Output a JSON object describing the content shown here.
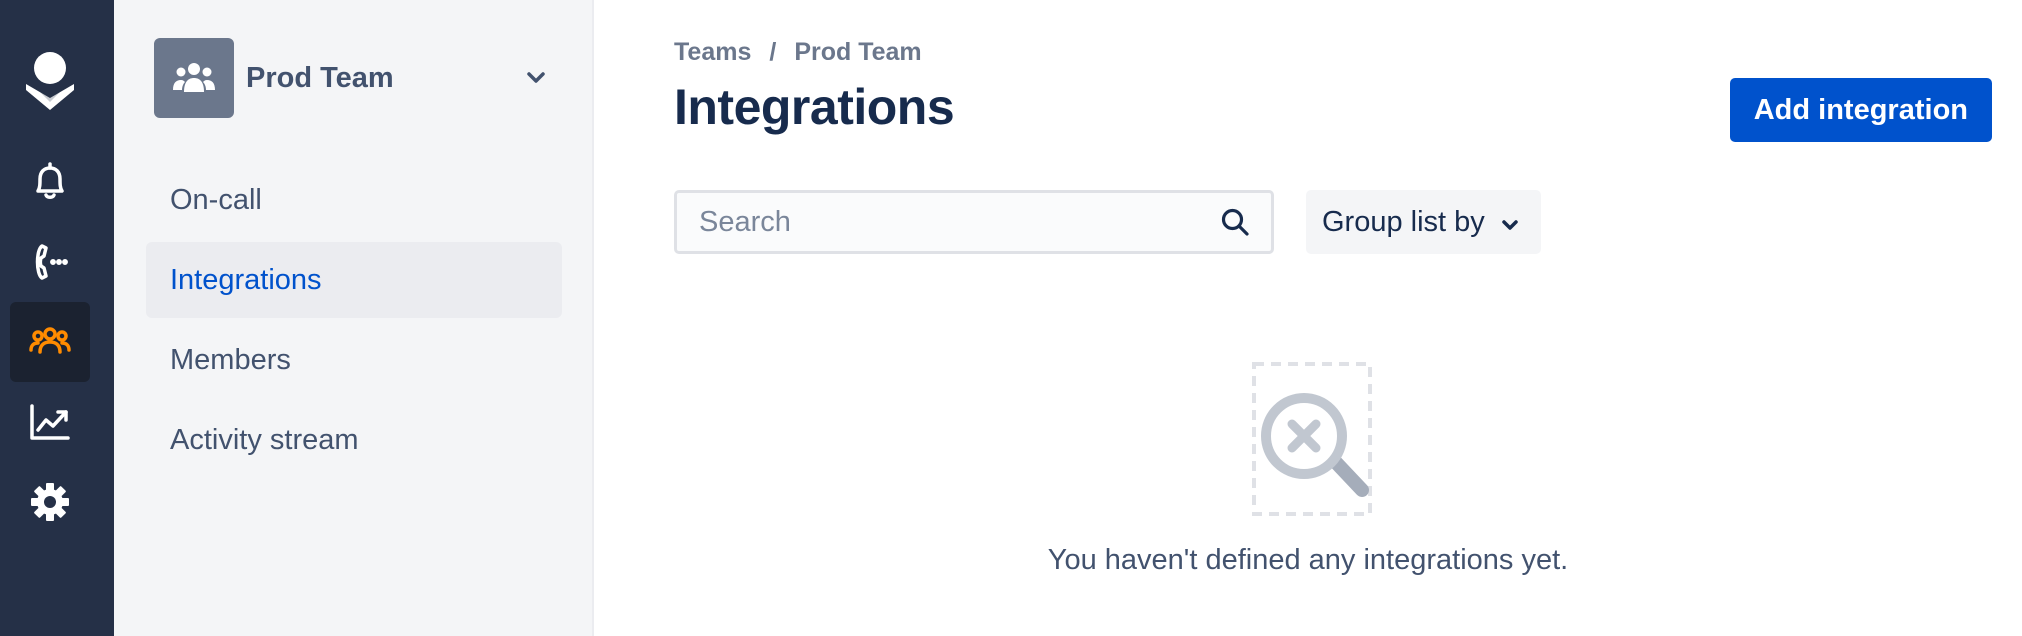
{
  "rail": {
    "items": [
      {
        "icon": "opsgenie-logo-icon"
      },
      {
        "icon": "bell-icon"
      },
      {
        "icon": "phone-icon"
      },
      {
        "icon": "teams-icon",
        "active": true
      },
      {
        "icon": "analytics-icon"
      },
      {
        "icon": "gear-icon"
      }
    ],
    "active_color": "#ff8b00"
  },
  "sidebar": {
    "team_name": "Prod Team",
    "items": [
      {
        "label": "On-call"
      },
      {
        "label": "Integrations",
        "selected": true
      },
      {
        "label": "Members"
      },
      {
        "label": "Activity stream"
      }
    ]
  },
  "main": {
    "breadcrumb": {
      "root": "Teams",
      "separator": "/",
      "current": "Prod Team"
    },
    "title": "Integrations",
    "add_button_label": "Add integration",
    "search": {
      "placeholder": "Search",
      "value": ""
    },
    "group_by_label": "Group list by",
    "empty_message": "You haven't defined any integrations yet."
  },
  "colors": {
    "rail_bg": "#253047",
    "primary": "#0052cc",
    "sidebar_bg": "#f4f5f7"
  }
}
